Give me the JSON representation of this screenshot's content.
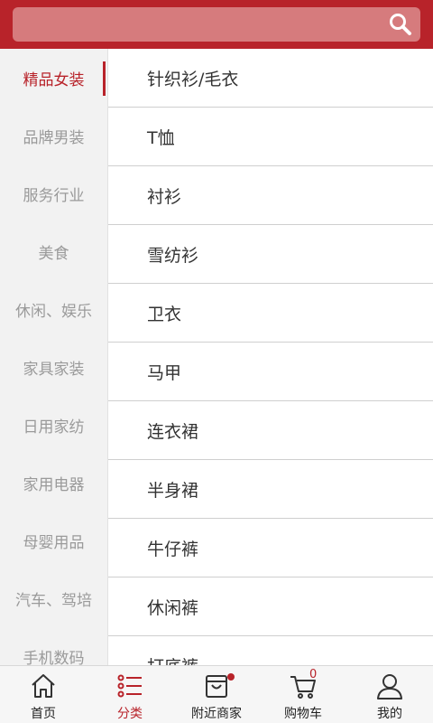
{
  "search": {
    "icon": "search-icon"
  },
  "sidebar": {
    "items": [
      {
        "label": "精品女装",
        "active": true
      },
      {
        "label": "品牌男装"
      },
      {
        "label": "服务行业"
      },
      {
        "label": "美食"
      },
      {
        "label": "休闲、娱乐"
      },
      {
        "label": "家具家装"
      },
      {
        "label": "日用家纺"
      },
      {
        "label": "家用电器"
      },
      {
        "label": "母婴用品"
      },
      {
        "label": "汽车、驾培"
      },
      {
        "label": "手机数码"
      }
    ]
  },
  "content": {
    "items": [
      "针织衫/毛衣",
      "T恤",
      "衬衫",
      "雪纺衫",
      "卫衣",
      "马甲",
      "连衣裙",
      "半身裙",
      "牛仔裤",
      "休闲裤",
      "打底裤"
    ]
  },
  "tabbar": {
    "home": "首页",
    "category": "分类",
    "nearby": "附近商家",
    "cart": "购物车",
    "cart_count": "0",
    "mine": "我的"
  },
  "colors": {
    "accent": "#b8232a"
  }
}
